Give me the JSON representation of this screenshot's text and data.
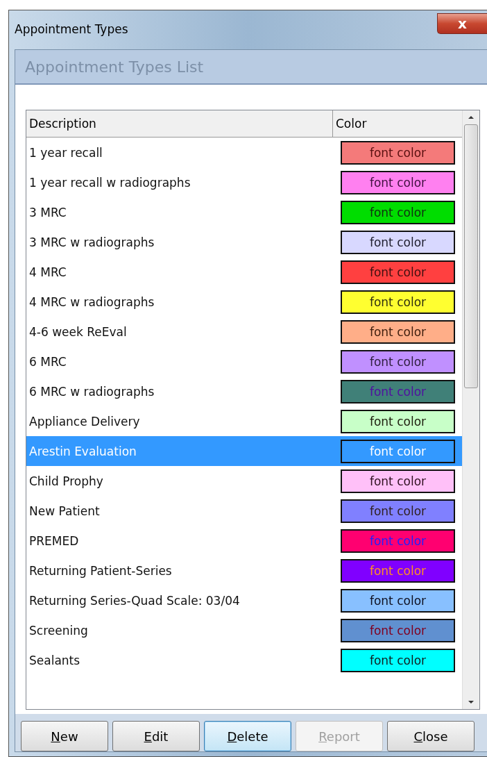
{
  "window": {
    "title": "Appointment Types",
    "close_symbol": "x"
  },
  "panel": {
    "title": "Appointment Types List"
  },
  "table": {
    "columns": [
      "Description",
      "Color"
    ],
    "rows": [
      {
        "description": "1 year recall",
        "swatch": {
          "label": "font color",
          "color": "#f47a7a",
          "font": {
            "color": "#5a1010"
          }
        },
        "selected": false
      },
      {
        "description": "1 year recall w radiographs",
        "swatch": {
          "label": "font color",
          "color": "#ff80f0",
          "font": {
            "color": "#401040"
          }
        },
        "selected": false
      },
      {
        "description": "3 MRC",
        "swatch": {
          "label": "font color",
          "color": "#00dd00",
          "font": {
            "color": "#103010"
          }
        },
        "selected": false
      },
      {
        "description": "3 MRC w radiographs",
        "swatch": {
          "label": "font color",
          "color": "#d8d8ff",
          "font": {
            "color": "#202030"
          }
        },
        "selected": false
      },
      {
        "description": "4 MRC",
        "swatch": {
          "label": "font color",
          "color": "#ff4040",
          "font": {
            "color": "#401010"
          }
        },
        "selected": false
      },
      {
        "description": "4 MRC w radiographs",
        "swatch": {
          "label": "font color",
          "color": "#ffff30",
          "font": {
            "color": "#303010"
          }
        },
        "selected": false
      },
      {
        "description": "4-6 week ReEval",
        "swatch": {
          "label": "font color",
          "color": "#ffae88",
          "font": {
            "color": "#402010"
          }
        },
        "selected": false
      },
      {
        "description": "6 MRC",
        "swatch": {
          "label": "font color",
          "color": "#c090ff",
          "font": {
            "color": "#302040"
          }
        },
        "selected": false
      },
      {
        "description": "6 MRC w radiographs",
        "swatch": {
          "label": "font color",
          "color": "#408078",
          "font": {
            "color": "#5010a0"
          }
        },
        "selected": false
      },
      {
        "description": "Appliance Delivery",
        "swatch": {
          "label": "font color",
          "color": "#c8ffc8",
          "font": {
            "color": "#202010"
          }
        },
        "selected": false
      },
      {
        "description": "Arestin Evaluation",
        "swatch": {
          "label": "font color",
          "color": "#3399ff",
          "font": {
            "color": "#ffffff"
          }
        },
        "selected": true
      },
      {
        "description": "Child Prophy",
        "swatch": {
          "label": "font color",
          "color": "#ffc0f8",
          "font": {
            "color": "#301020"
          }
        },
        "selected": false
      },
      {
        "description": "New Patient",
        "swatch": {
          "label": "font color",
          "color": "#8080ff",
          "font": {
            "color": "#302020"
          }
        },
        "selected": false
      },
      {
        "description": "PREMED",
        "swatch": {
          "label": "font color",
          "color": "#ff0070",
          "font": {
            "color": "#2020ff"
          }
        },
        "selected": false
      },
      {
        "description": "Returning Patient-Series",
        "swatch": {
          "label": "font color",
          "color": "#8000ff",
          "font": {
            "color": "#ff9020"
          }
        },
        "selected": false
      },
      {
        "description": "Returning Series-Quad Scale:  03/04",
        "swatch": {
          "label": "font color",
          "color": "#88c0ff",
          "font": {
            "color": "#101020"
          }
        },
        "selected": false
      },
      {
        "description": "Screening",
        "swatch": {
          "label": "font color",
          "color": "#6090d0",
          "font": {
            "color": "#800020"
          }
        },
        "selected": false
      },
      {
        "description": "Sealants",
        "swatch": {
          "label": "font color",
          "color": "#00ffff",
          "font": {
            "color": "#102020"
          }
        },
        "selected": false
      }
    ]
  },
  "buttons": [
    {
      "label": "New",
      "focused": false,
      "disabled": false
    },
    {
      "label": "Edit",
      "focused": false,
      "disabled": false
    },
    {
      "label": "Delete",
      "focused": true,
      "disabled": false
    },
    {
      "label": "Report",
      "focused": false,
      "disabled": true
    },
    {
      "label": "Close",
      "focused": false,
      "disabled": false
    }
  ]
}
